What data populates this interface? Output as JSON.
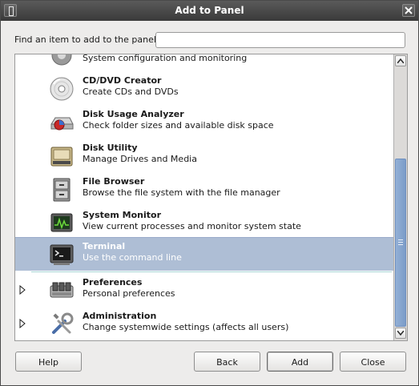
{
  "window": {
    "title": "Add to Panel"
  },
  "search": {
    "label": "Find an item to add to the panel:",
    "value": "",
    "placeholder": ""
  },
  "items": [
    {
      "name": "",
      "desc": "System configuration and monitoring",
      "icon": "system-tools-icon"
    },
    {
      "name": "CD/DVD Creator",
      "desc": "Create CDs and DVDs",
      "icon": "cd-dvd-icon"
    },
    {
      "name": "Disk Usage Analyzer",
      "desc": "Check folder sizes and available disk space",
      "icon": "disk-usage-icon"
    },
    {
      "name": "Disk Utility",
      "desc": "Manage Drives and Media",
      "icon": "hard-drive-icon"
    },
    {
      "name": "File Browser",
      "desc": "Browse the file system with the file manager",
      "icon": "file-cabinet-icon"
    },
    {
      "name": "System Monitor",
      "desc": "View current processes and monitor system state",
      "icon": "system-monitor-icon"
    },
    {
      "name": "Terminal",
      "desc": "Use the command line",
      "icon": "terminal-icon",
      "selected": true
    },
    {
      "name": "Preferences",
      "desc": "Personal preferences",
      "icon": "preferences-icon",
      "expandable": true
    },
    {
      "name": "Administration",
      "desc": "Change systemwide settings (affects all users)",
      "icon": "administration-icon",
      "expandable": true
    }
  ],
  "buttons": {
    "help": "Help",
    "back": "Back",
    "add": "Add",
    "close": "Close"
  },
  "colors": {
    "selection": "#aebed5",
    "scroll_thumb": "#7b9cc8",
    "titlebar": "#3a3a3a"
  }
}
